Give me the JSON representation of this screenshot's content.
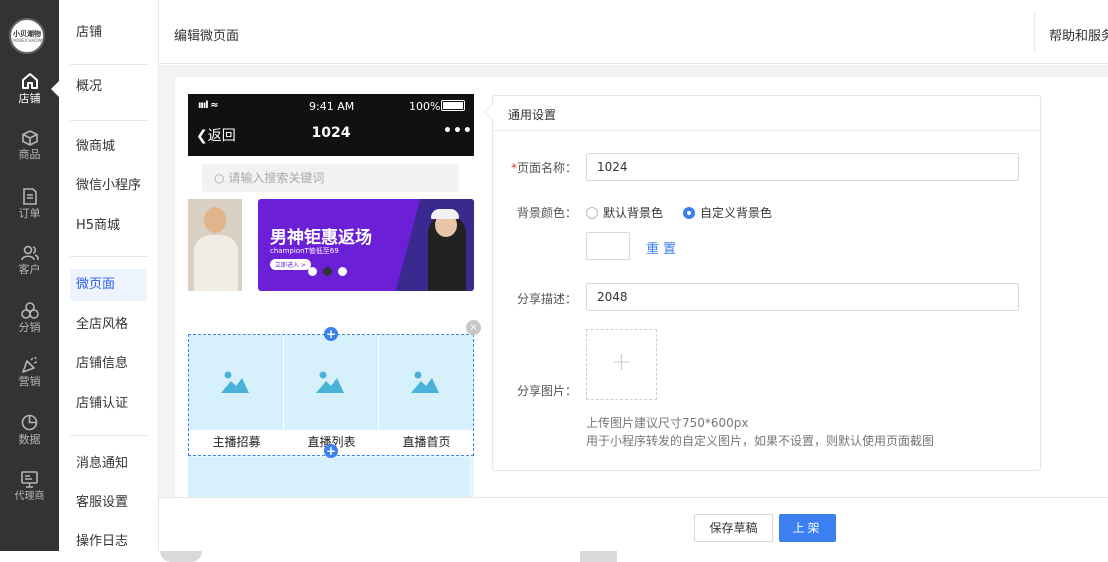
{
  "logo": {
    "text": "小贝潮物",
    "sub": "XIAOBEICHAOWU"
  },
  "rail": [
    {
      "key": "shop",
      "label": "店铺",
      "icon": "home-icon",
      "active": true
    },
    {
      "key": "goods",
      "label": "商品",
      "icon": "cube-icon"
    },
    {
      "key": "orders",
      "label": "订单",
      "icon": "document-icon"
    },
    {
      "key": "customers",
      "label": "客户",
      "icon": "users-icon"
    },
    {
      "key": "distribution",
      "label": "分销",
      "icon": "share-icon"
    },
    {
      "key": "marketing",
      "label": "营销",
      "icon": "party-popper-icon"
    },
    {
      "key": "data",
      "label": "数据",
      "icon": "pie-chart-icon"
    },
    {
      "key": "agent",
      "label": "代理商",
      "icon": "monitor-icon"
    }
  ],
  "sidebar": {
    "header": "店铺",
    "items": [
      "概况",
      "微商城",
      "微信小程序",
      "H5商城",
      "微页面",
      "全店风格",
      "店铺信息",
      "店铺认证",
      "消息通知",
      "客服设置",
      "操作日志"
    ],
    "active": "微页面"
  },
  "header": {
    "title": "编辑微页面",
    "help": "帮助和服务"
  },
  "phone": {
    "signal": "ıııl ≈",
    "time": "9:41 AM",
    "battery": "100%",
    "back": "返回",
    "title": "1024",
    "more": "•••",
    "search_placeholder": "请输入搜索关键词",
    "banner": {
      "headline": "男神钜惠返场",
      "sub": "championT恤低至69",
      "cta": "立即进入 >"
    },
    "nav_items": [
      "主播招募",
      "直播列表",
      "直播首页"
    ],
    "add_symbol": "+",
    "close_symbol": "×"
  },
  "settings": {
    "section_title": "通用设置",
    "page_name_label": "页面名称：",
    "page_name_required": "*",
    "page_name_value": "1024",
    "bg_color_label": "背景颜色：",
    "bg_default": "默认背景色",
    "bg_custom": "自定义背景色",
    "bg_selected": "custom",
    "reset_label": "重置",
    "share_desc_label": "分享描述：",
    "share_desc_value": "2048",
    "share_image_label": "分享图片：",
    "upload_symbol": "+",
    "hint_1": "上传图片建议尺寸750*600px",
    "hint_2": "用于小程序转发的自定义图片，如果不设置，则默认使用页面截图"
  },
  "footer": {
    "save_draft": "保存草稿",
    "publish": "上架"
  },
  "colors": {
    "accent": "#3b7ff0",
    "rail": "#333333",
    "active_bg": "#eef4fe",
    "banner": "#6b1fd6"
  }
}
